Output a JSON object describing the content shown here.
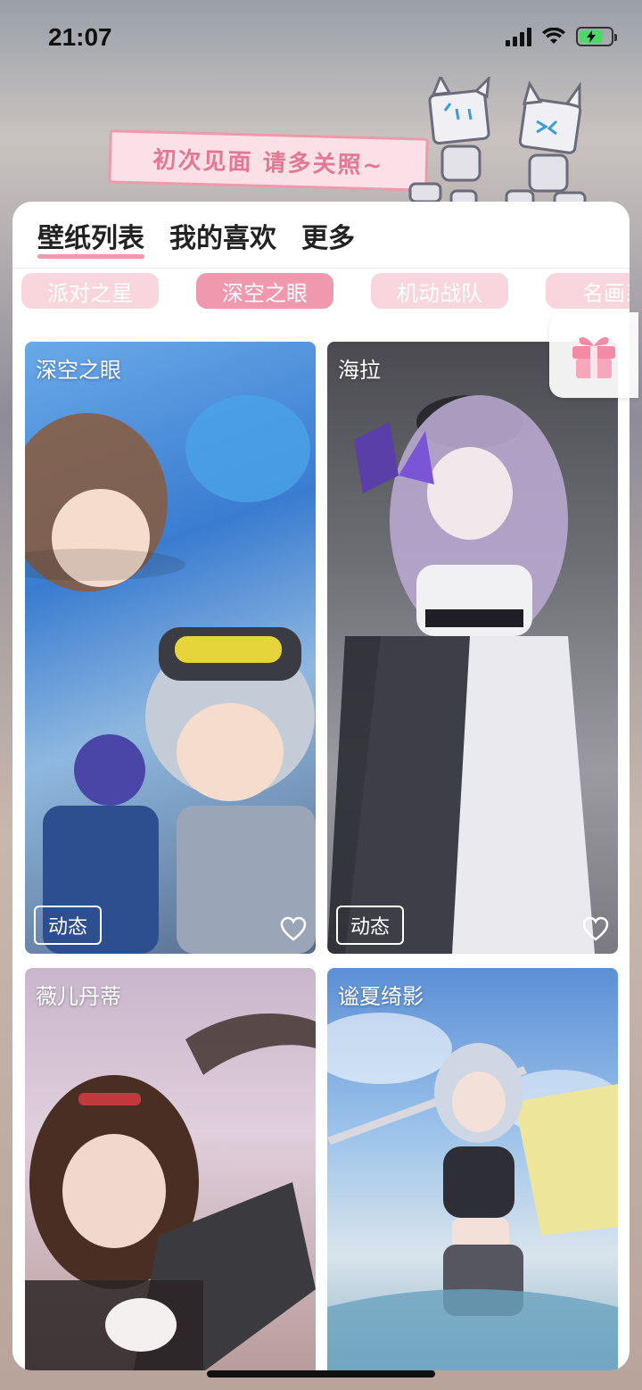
{
  "status_bar": {
    "time": "21:07",
    "battery_level": 0.75,
    "battery_color": "#4cd964"
  },
  "banner": {
    "text": "初次见面 请多关照~"
  },
  "tabs": [
    {
      "label": "壁纸列表",
      "active": true
    },
    {
      "label": "我的喜欢",
      "active": false
    },
    {
      "label": "更多",
      "active": false
    }
  ],
  "chips": [
    {
      "label": "派对之星",
      "active": false
    },
    {
      "label": "深空之眼",
      "active": true
    },
    {
      "label": "机动战队",
      "active": false
    },
    {
      "label": "名画系",
      "active": false
    }
  ],
  "wallpapers": [
    {
      "title": "深空之眼",
      "badge": "动态",
      "icon": "heart-outline-icon"
    },
    {
      "title": "海拉",
      "badge": "动态",
      "icon": "heart-outline-icon"
    },
    {
      "title": "薇儿丹蒂",
      "badge": "",
      "icon": ""
    },
    {
      "title": "谧夏绮影",
      "badge": "",
      "icon": ""
    }
  ],
  "colors": {
    "accent_pink": "#ef98ae",
    "chip_pink": "#f9d6de",
    "banner_pink": "#e27893"
  },
  "icons": {
    "gift": "gift-icon",
    "signal": "signal-icon",
    "wifi": "wifi-icon",
    "battery": "battery-charging-icon"
  }
}
